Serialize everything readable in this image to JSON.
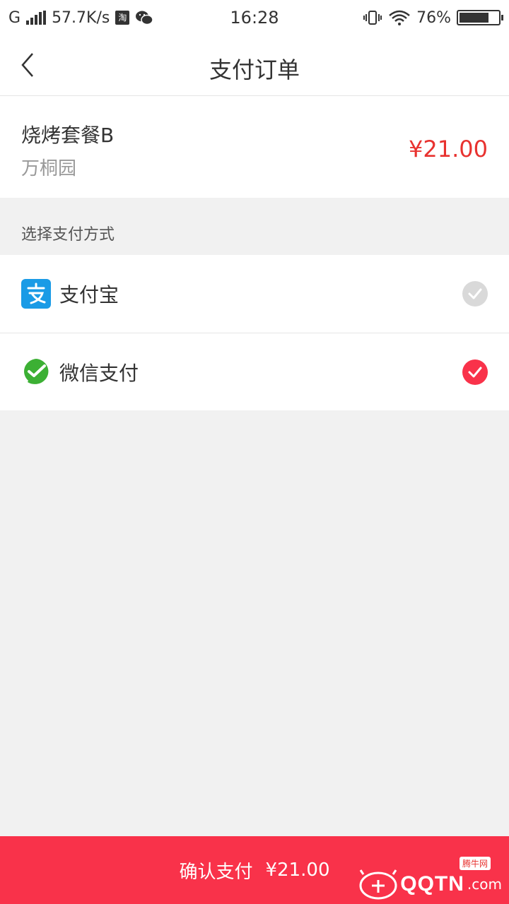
{
  "statusbar": {
    "network_type": "G",
    "speed": "57.7K/s",
    "taobao_icon_text": "淘",
    "time": "16:28",
    "battery": "76%",
    "battery_level": 0.76
  },
  "nav": {
    "title": "支付订单"
  },
  "order": {
    "name": "烧烤套餐B",
    "shop": "万桐园",
    "price": "¥21.00"
  },
  "payment": {
    "section_label": "选择支付方式",
    "methods": [
      {
        "label": "支付宝",
        "icon": "alipay-icon",
        "selected": false
      },
      {
        "label": "微信支付",
        "icon": "wechat-pay-icon",
        "selected": true
      }
    ]
  },
  "confirm": {
    "label": "确认支付",
    "amount": "¥21.00"
  },
  "watermark": {
    "text": "QQTN",
    "suffix": ".com",
    "badge": "腾牛网"
  },
  "colors": {
    "accent": "#f9324a",
    "price": "#e8322f",
    "alipay": "#1a9be6",
    "wechat": "#3cb034",
    "check_off": "#d9d9d9"
  }
}
